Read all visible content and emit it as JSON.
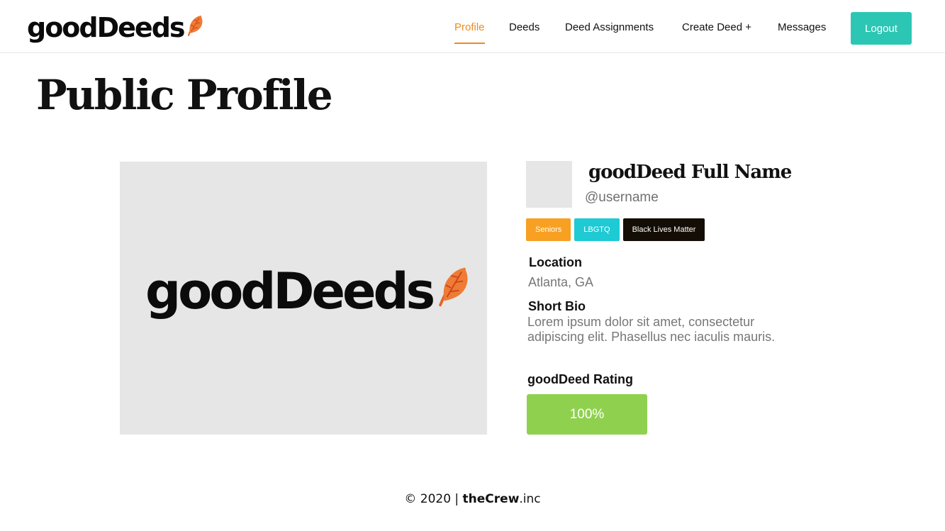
{
  "header": {
    "brand": "goodDeeds",
    "nav": [
      {
        "label": "Profile",
        "active": true
      },
      {
        "label": "Deeds",
        "active": false
      },
      {
        "label": "Deed Assignments",
        "active": false
      },
      {
        "label": "Create Deed +",
        "active": false
      },
      {
        "label": "Messages",
        "active": false
      }
    ],
    "logout_label": "Logout"
  },
  "page": {
    "title": "Public Profile"
  },
  "cover": {
    "logo_text": "goodDeeds",
    "logo_icon": "leaf-icon"
  },
  "profile": {
    "full_name": "goodDeed Full Name",
    "username": "@username",
    "tags": [
      {
        "label": "Seniors",
        "color": "#f7a021"
      },
      {
        "label": "LBGTQ",
        "color": "#1ecad3"
      },
      {
        "label": "Black Lives Matter",
        "color": "#130d05"
      }
    ],
    "location_label": "Location",
    "location_value": "Atlanta, GA",
    "bio_label": "Short Bio",
    "bio_value": "Lorem ipsum dolor sit amet, consectetur adipiscing elit. Phasellus nec iaculis mauris.",
    "rating_label": "goodDeed Rating",
    "rating_value": "100%"
  },
  "footer": {
    "copyright": "© 2020 | ",
    "company_bold": "theCrew",
    "company_suffix": ".inc"
  },
  "colors": {
    "accent_orange": "#f08a1c",
    "logout_teal": "#2cc6b4",
    "rating_green": "#8fd14f",
    "placeholder_gray": "#e6e6e6"
  }
}
